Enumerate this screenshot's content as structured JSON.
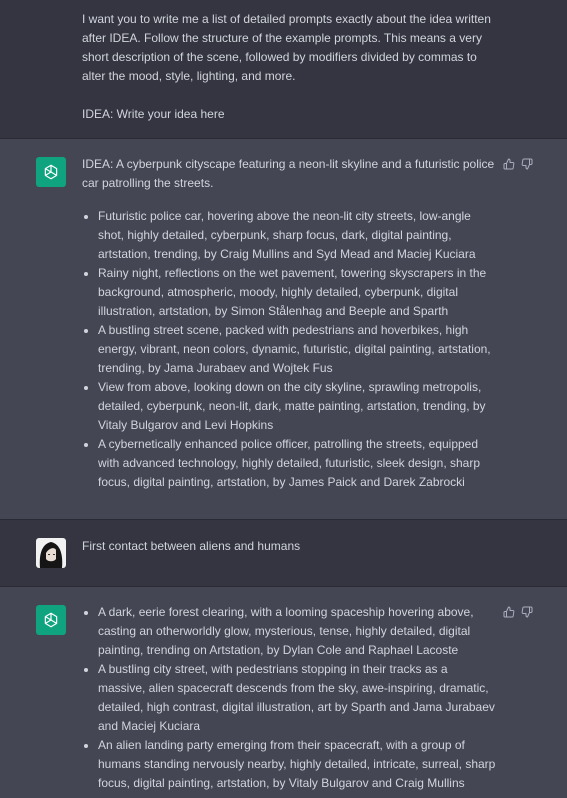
{
  "messages": [
    {
      "role": "user",
      "text": "I want you to write me a list of detailed prompts exactly about the idea written after IDEA. Follow the structure of the example prompts. This means a very short description of the scene, followed by modifiers divided by commas to alter the mood, style, lighting, and more.",
      "idea": "IDEA: Write your idea here"
    },
    {
      "role": "assistant",
      "intro": "IDEA: A cyberpunk cityscape featuring a neon-lit skyline and a futuristic police car patrolling the streets.",
      "items": [
        "Futuristic police car, hovering above the neon-lit city streets, low-angle shot, highly detailed, cyberpunk, sharp focus, dark, digital painting, artstation, trending, by Craig Mullins and Syd Mead and Maciej Kuciara",
        "Rainy night, reflections on the wet pavement, towering skyscrapers in the background, atmospheric, moody, highly detailed, cyberpunk, digital illustration, artstation, by Simon Stålenhag and Beeple and Sparth",
        "A bustling street scene, packed with pedestrians and hoverbikes, high energy, vibrant, neon colors, dynamic, futuristic, digital painting, artstation, trending, by Jama Jurabaev and Wojtek Fus",
        "View from above, looking down on the city skyline, sprawling metropolis, detailed, cyberpunk, neon-lit, dark, matte painting, artstation, trending, by Vitaly Bulgarov and Levi Hopkins",
        "A cybernetically enhanced police officer, patrolling the streets, equipped with advanced technology, highly detailed, futuristic, sleek design, sharp focus, digital painting, artstation, by James Paick and Darek Zabrocki"
      ]
    },
    {
      "role": "user",
      "text": "First contact between aliens and humans"
    },
    {
      "role": "assistant",
      "items": [
        "A dark, eerie forest clearing, with a looming spaceship hovering above, casting an otherworldly glow, mysterious, tense, highly detailed, digital painting, trending on Artstation, by Dylan Cole and Raphael Lacoste",
        "A bustling city street, with pedestrians stopping in their tracks as a massive, alien spacecraft descends from the sky, awe-inspiring, dramatic, detailed, high contrast, digital illustration, art by Sparth and Jama Jurabaev and Maciej Kuciara",
        "An alien landing party emerging from their spacecraft, with a group of humans standing nervously nearby, highly detailed, intricate, surreal, sharp focus, digital painting, artstation, by Vitaly Bulgarov and Craig Mullins"
      ]
    }
  ],
  "icons": {
    "assistant_avatar": "openai-logo-icon",
    "thumbs_up": "thumbs-up-icon",
    "thumbs_down": "thumbs-down-icon"
  },
  "colors": {
    "user_bg": "#343541",
    "assistant_bg": "#444654",
    "avatar_green": "#10a37f",
    "text": "#d1d5db"
  }
}
